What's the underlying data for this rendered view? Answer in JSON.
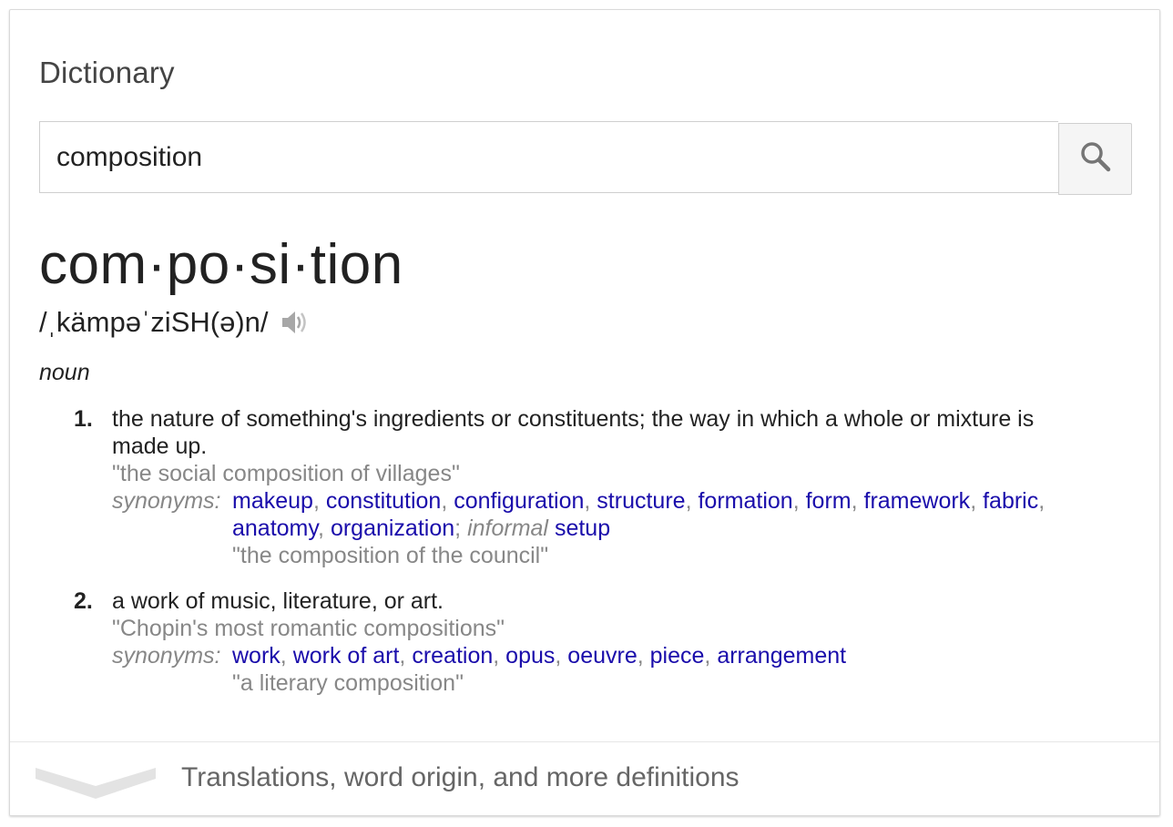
{
  "card": {
    "title": "Dictionary"
  },
  "search": {
    "value": "composition",
    "icon": "search-icon"
  },
  "entry": {
    "headword": "com·po·si·tion",
    "phonetic": "/ˌkämpəˈziSH(ə)n/",
    "part_of_speech": "noun",
    "senses": [
      {
        "number": "1.",
        "definition": "the nature of something's ingredients or constituents; the way in which a whole or mixture is made up.",
        "example": "\"the social composition of villages\"",
        "synonyms_label": "synonyms:",
        "synonyms": [
          "makeup",
          "constitution",
          "configuration",
          "structure",
          "formation",
          "form",
          "framework",
          "fabric",
          "anatomy",
          "organization"
        ],
        "informal_label": "informal",
        "informal_synonym": "setup",
        "synonym_example": "\"the composition of the council\""
      },
      {
        "number": "2.",
        "definition": "a work of music, literature, or art.",
        "example": "\"Chopin's most romantic compositions\"",
        "synonyms_label": "synonyms:",
        "synonyms": [
          "work",
          "work of art",
          "creation",
          "opus",
          "oeuvre",
          "piece",
          "arrangement"
        ],
        "synonym_example": "\"a literary composition\""
      }
    ]
  },
  "footer": {
    "label": "Translations, word origin, and more definitions",
    "icon": "chevron-down-icon"
  },
  "colors": {
    "link": "#1a0dab",
    "muted": "#878787",
    "text": "#222222"
  }
}
